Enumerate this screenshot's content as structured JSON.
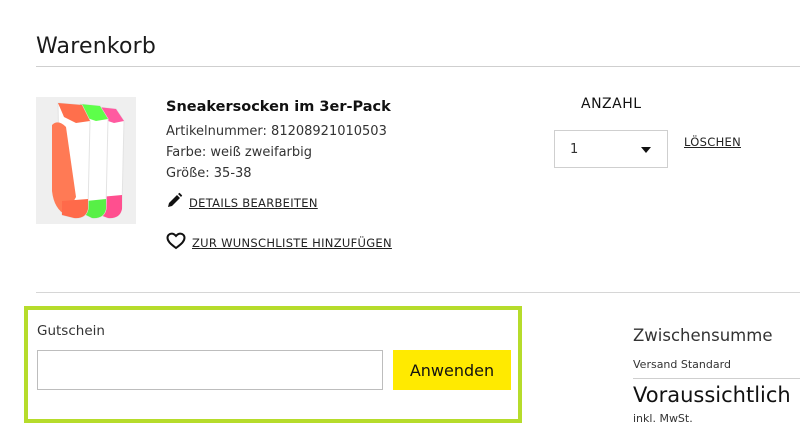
{
  "page": {
    "title": "Warenkorb"
  },
  "cart_item": {
    "name": "Sneakersocken im 3er-Pack",
    "article_number": "Artikelnummer: 81208921010503",
    "color": "Farbe: weiß zweifarbig",
    "size": "Größe: 35-38",
    "edit_label": "DETAILS BEARBEITEN",
    "wishlist_label": "ZUR WUNSCHLISTE HINZUFÜGEN",
    "quantity_header": "ANZAHL",
    "quantity_value": "1",
    "delete_label": "LÖSCHEN",
    "image_icon": "socks-product-image"
  },
  "coupon": {
    "label": "Gutschein",
    "input_value": "",
    "apply_label": "Anwenden",
    "highlight_color": "#b6dc2b",
    "button_color": "#ffea00"
  },
  "summary": {
    "subtotal_label": "Zwischensumme",
    "shipping_label": "Versand Standard",
    "total_label": "Voraussichtlich",
    "vat_label": "inkl. MwSt."
  }
}
